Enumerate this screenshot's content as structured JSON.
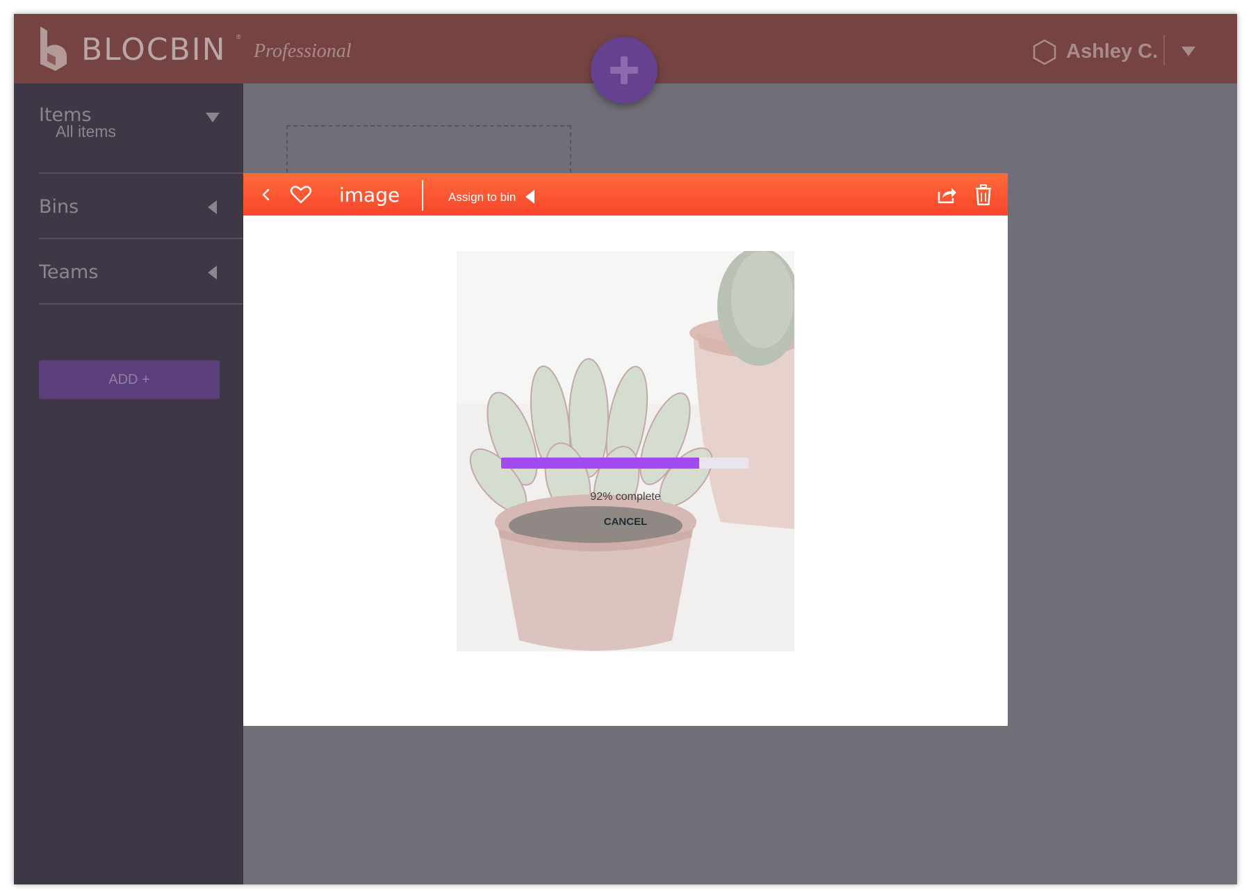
{
  "header": {
    "brand": "BLOCBIN",
    "brand_mark": "®",
    "edition": "Professional",
    "user_name": "Ashley C."
  },
  "sidebar": {
    "sections": [
      {
        "label": "Items",
        "sub": "All items",
        "expanded": true
      },
      {
        "label": "Bins",
        "expanded": false
      },
      {
        "label": "Teams",
        "expanded": false
      }
    ],
    "add_button": "ADD +"
  },
  "modal": {
    "title": "image",
    "assign_label": "Assign to bin",
    "progress": {
      "percent": 92,
      "bar_fill": 0.8,
      "text": "92% complete"
    },
    "cancel_label": "CANCEL"
  },
  "colors": {
    "header_dimmed": "#754442",
    "sidebar_dimmed": "#3e3745",
    "overlay": "#716e77",
    "fab": "#66418f",
    "modal_bar": "#f7462c",
    "progress": "#a549f0"
  },
  "icons": [
    "blocbin-logo-icon",
    "plus-icon",
    "hexagon-user-icon",
    "chevron-down-icon",
    "back-chevron-icon",
    "heart-icon",
    "share-icon",
    "trash-icon"
  ]
}
